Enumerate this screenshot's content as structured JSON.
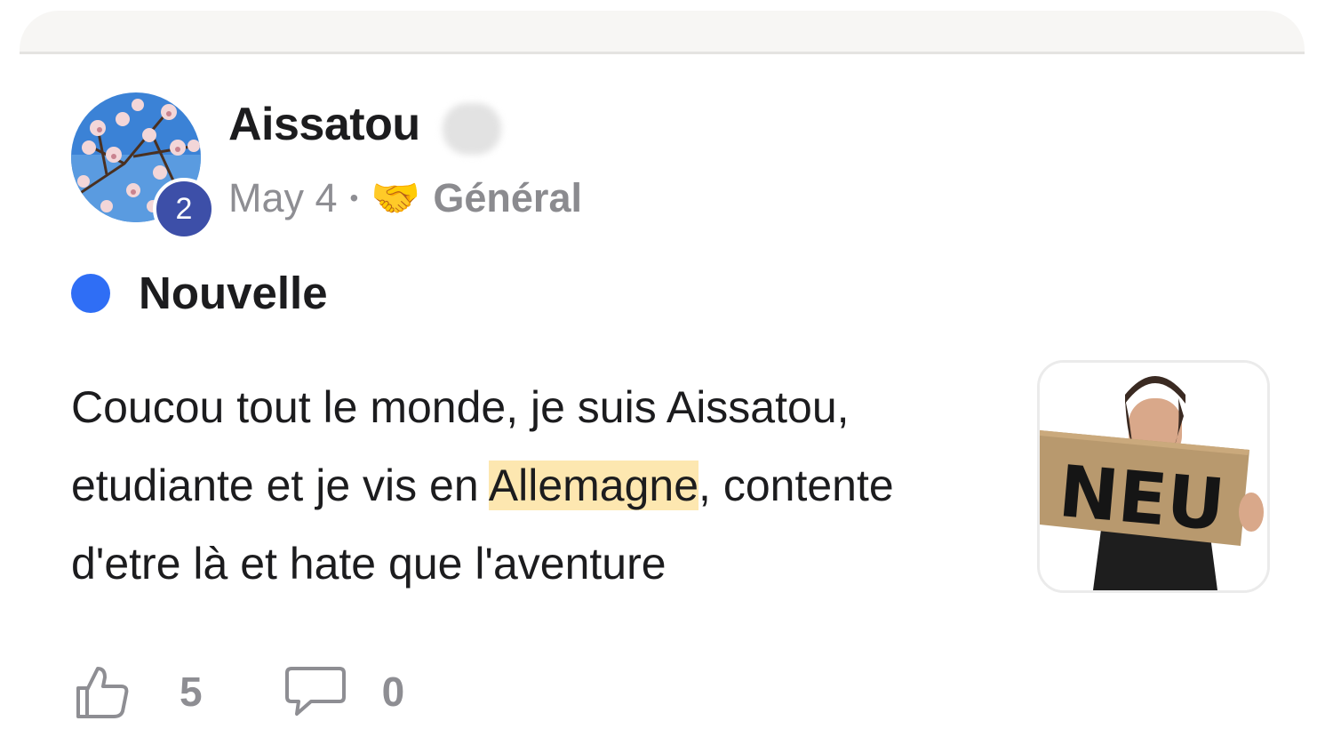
{
  "post": {
    "author": "Aissatou",
    "author_level": "2",
    "date": "May 4",
    "separator": "•",
    "category_emoji": "🤝",
    "category": "Général",
    "tag": "Nouvelle",
    "body": {
      "before": "Coucou tout le monde, je suis Aissatou, etudiante et je vis en ",
      "highlight": "Allemagne",
      "after": ", contente d'etre là et hate que l'aventure"
    },
    "attachment_caption": "NEU",
    "likes": "5",
    "comments": "0"
  },
  "icons": {
    "like": "thumbs-up-icon",
    "comment": "speech-bubble-icon",
    "unread": "unread-dot-icon"
  },
  "colors": {
    "accent": "#2f6ef5",
    "level_badge": "#3d4fa8",
    "highlight": "#fde7b0",
    "muted": "#8e8e93"
  }
}
